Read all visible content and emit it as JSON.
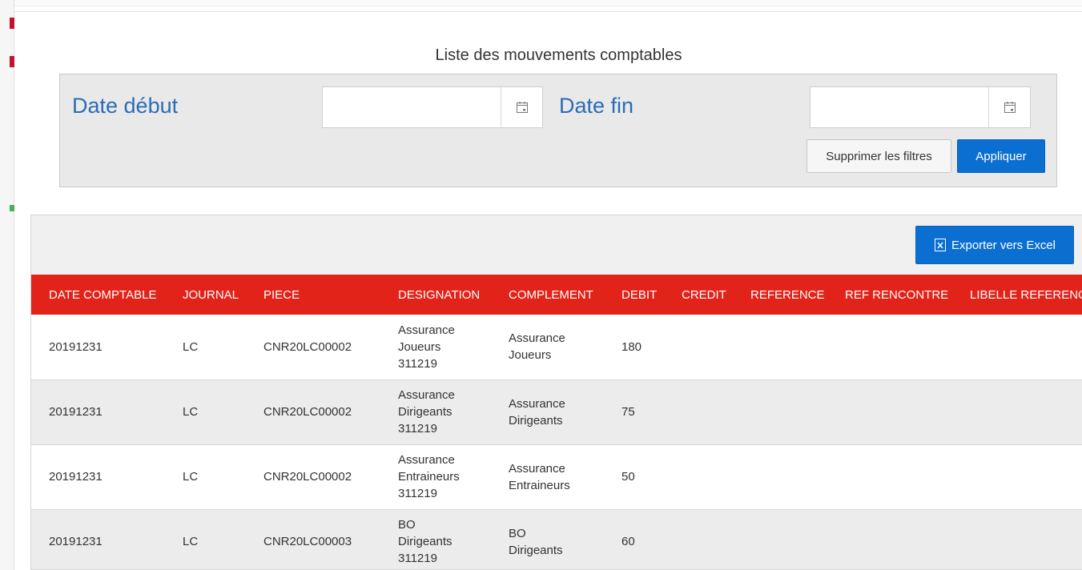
{
  "page": {
    "title": "Liste des mouvements comptables"
  },
  "filters": {
    "date_start_label": "Date début",
    "date_start_value": "",
    "date_end_label": "Date fin",
    "date_end_value": "",
    "clear_label": "Supprimer les filtres",
    "apply_label": "Appliquer"
  },
  "grid": {
    "export_label": "Exporter vers Excel",
    "columns": [
      "DATE COMPTABLE",
      "JOURNAL",
      "PIECE",
      "DESIGNATION",
      "COMPLEMENT",
      "DEBIT",
      "CREDIT",
      "REFERENCE",
      "REF RENCONTRE",
      "LIBELLE REFERENCE"
    ],
    "rows": [
      {
        "date": "20191231",
        "journal": "LC",
        "piece": "CNR20LC00002",
        "designation": [
          "Assurance",
          "Joueurs",
          "311219"
        ],
        "complement": [
          "Assurance",
          "Joueurs"
        ],
        "debit": "180",
        "credit": "",
        "reference": "",
        "ref_rencontre": "",
        "libelle_reference": ""
      },
      {
        "date": "20191231",
        "journal": "LC",
        "piece": "CNR20LC00002",
        "designation": [
          "Assurance",
          "Dirigeants",
          "311219"
        ],
        "complement": [
          "Assurance",
          "Dirigeants"
        ],
        "debit": "75",
        "credit": "",
        "reference": "",
        "ref_rencontre": "",
        "libelle_reference": ""
      },
      {
        "date": "20191231",
        "journal": "LC",
        "piece": "CNR20LC00002",
        "designation": [
          "Assurance",
          "Entraineurs",
          "311219"
        ],
        "complement": [
          "Assurance",
          "Entraineurs"
        ],
        "debit": "50",
        "credit": "",
        "reference": "",
        "ref_rencontre": "",
        "libelle_reference": ""
      },
      {
        "date": "20191231",
        "journal": "LC",
        "piece": "CNR20LC00003",
        "designation": [
          "BO",
          "Dirigeants",
          "311219"
        ],
        "complement": [
          "BO",
          "Dirigeants"
        ],
        "debit": "60",
        "credit": "",
        "reference": "",
        "ref_rencontre": "",
        "libelle_reference": ""
      }
    ]
  },
  "colors": {
    "header_red": "#e2231a",
    "primary_blue": "#0b6fd1",
    "label_blue": "#2b6cb6"
  }
}
